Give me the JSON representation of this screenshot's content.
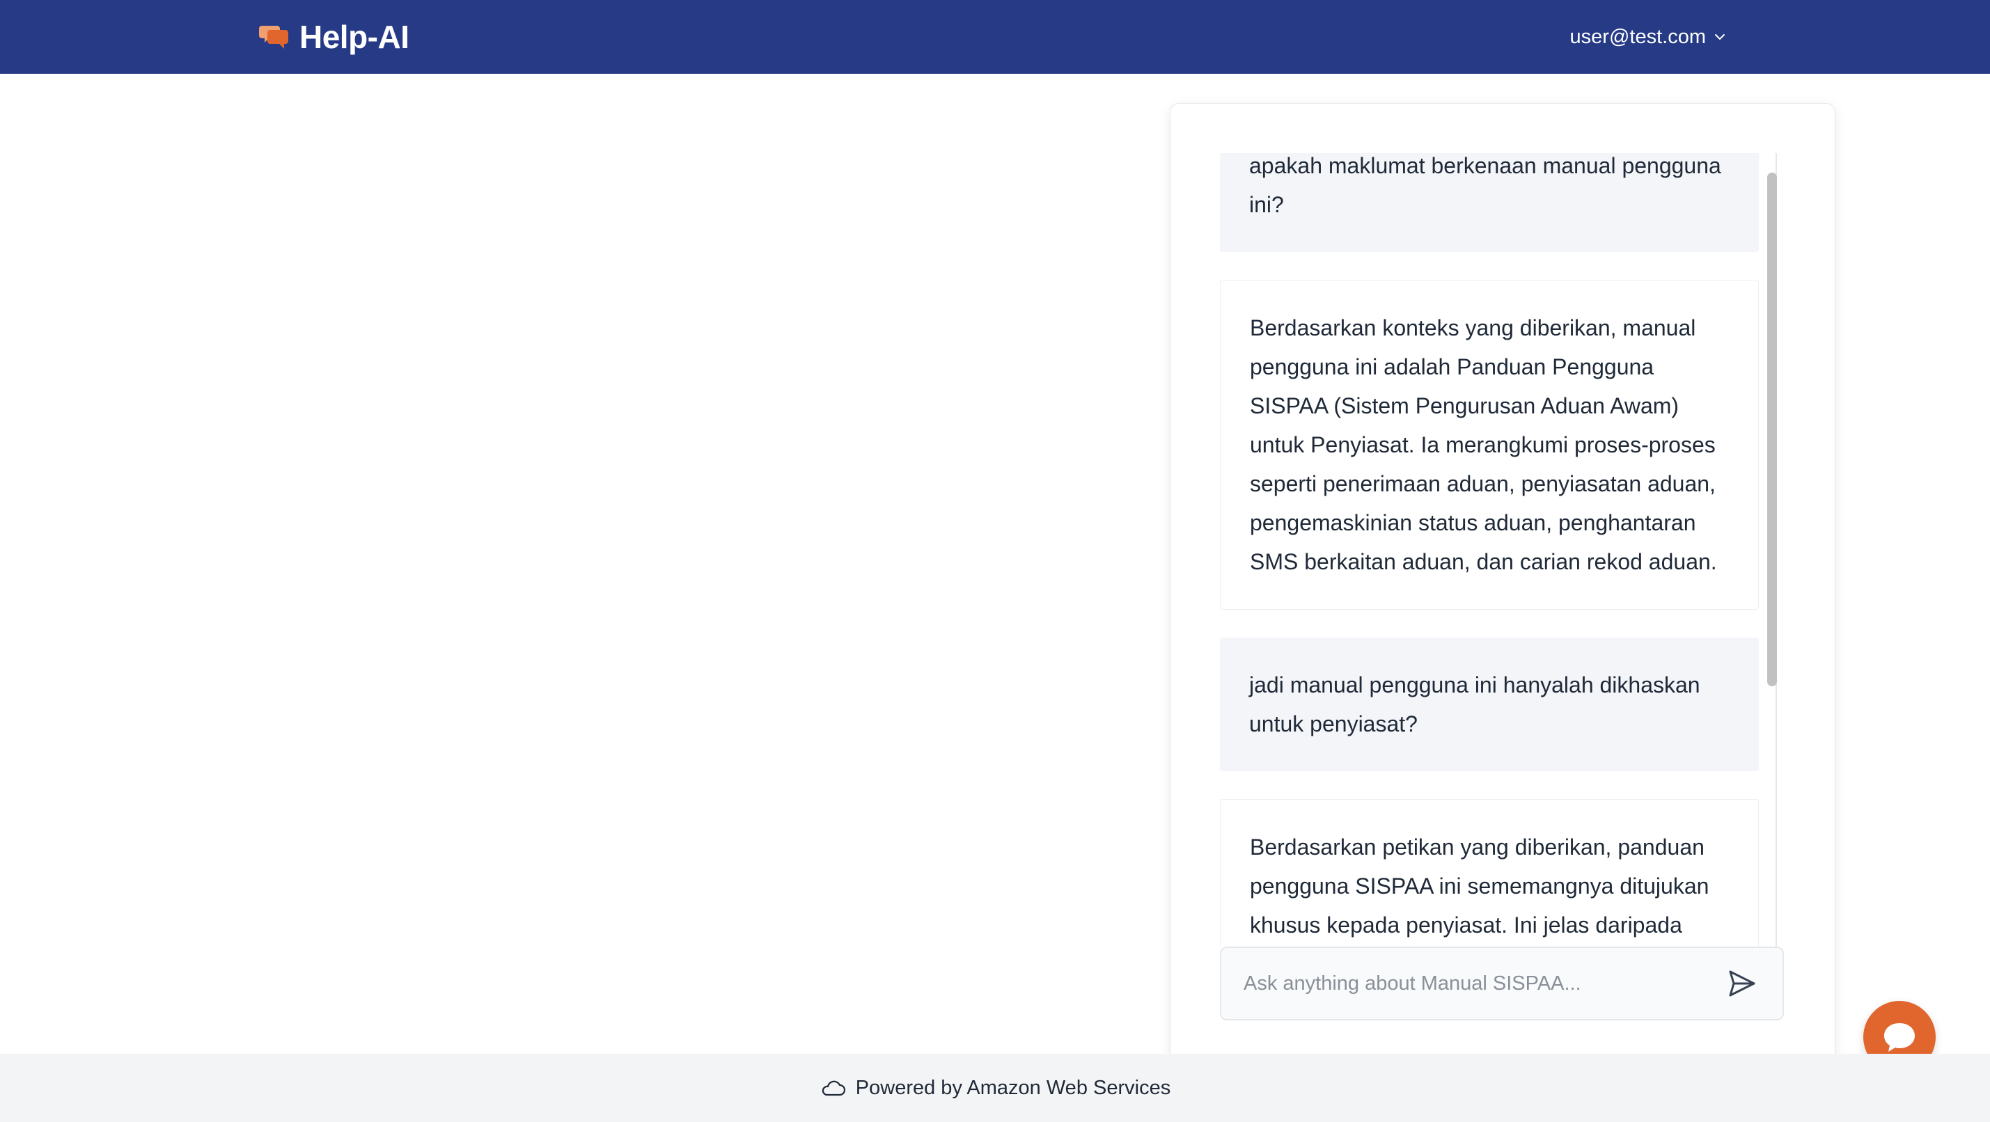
{
  "header": {
    "brand_name": "Help-AI",
    "brand_icon": "chat-bubbles-icon",
    "user_email": "user@test.com"
  },
  "chat": {
    "messages": [
      {
        "role": "user",
        "text": "apakah maklumat berkenaan manual pengguna ini?"
      },
      {
        "role": "assistant",
        "text": "Berdasarkan konteks yang diberikan, manual pengguna ini adalah Panduan Pengguna SISPAA (Sistem Pengurusan Aduan Awam) untuk Penyiasat. Ia merangkumi proses-proses seperti penerimaan aduan, penyiasatan aduan, pengemaskinian status aduan, penghantaran SMS berkaitan aduan, dan carian rekod aduan."
      },
      {
        "role": "user",
        "text": "jadi manual pengguna ini hanyalah dikhaskan untuk penyiasat?"
      },
      {
        "role": "assistant",
        "text": "Berdasarkan petikan yang diberikan, panduan pengguna SISPAA ini sememangnya ditujukan khusus kepada penyiasat. Ini jelas daripada tajuk panduan pengguna tersebut, iaitu"
      }
    ],
    "input_value": "",
    "input_placeholder": "Ask anything about Manual SISPAA..."
  },
  "footer": {
    "text": "Powered by Amazon Web Services"
  },
  "colors": {
    "header_bg": "#263a86",
    "accent": "#e0662d",
    "user_bubble_bg": "#f3f5f9",
    "footer_bg": "#f3f4f6"
  }
}
